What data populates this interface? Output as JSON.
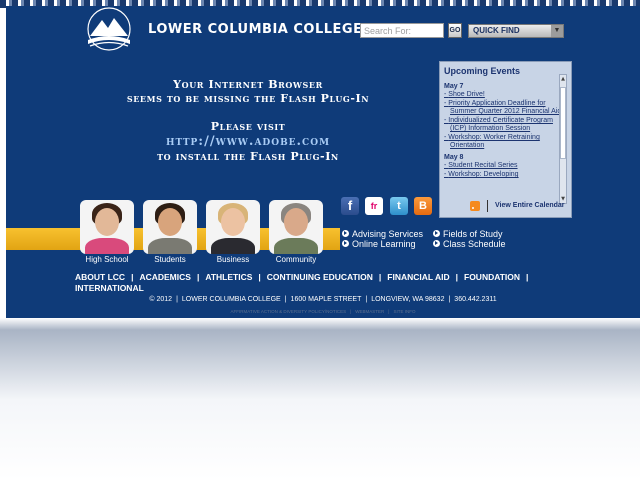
{
  "header": {
    "college_name": "LOWER COLUMBIA COLLEGE",
    "search_placeholder": "Search For:",
    "go_label": "GO",
    "quick_find_label": "QUICK FIND"
  },
  "flash_notice": {
    "line1": "Your Internet Browser",
    "line2": "seems to be missing the Flash Plug-In",
    "line3": "Please visit",
    "link": "http://www.adobe.com",
    "line4": "to install the Flash Plug-In"
  },
  "events": {
    "title": "Upcoming Events",
    "days": [
      {
        "date": "May 7",
        "items": [
          "Shoe Drive!",
          "Priority Application Deadline for Summer Quarter 2012 Financial Aid",
          "Individualized Certificate Program (ICP) Information Session",
          "Workshop: Worker Retraining Orientation"
        ]
      },
      {
        "date": "May 8",
        "items": [
          "Student Recital Series",
          "Workshop: Developing"
        ]
      }
    ],
    "view_calendar_label": "View Entire Calendar"
  },
  "social_icons": [
    "facebook-icon",
    "flickr-icon",
    "twitter-icon",
    "blogger-icon"
  ],
  "social_glyphs": {
    "facebook": "f",
    "flickr": "fr",
    "twitter": "t",
    "blogger": "B"
  },
  "quick_links": {
    "advising": "Advising Services",
    "fields": "Fields of Study",
    "online": "Online Learning",
    "schedule": "Class Schedule"
  },
  "audiences": {
    "high_school": "High School",
    "students": "Students",
    "business": "Business",
    "community": "Community"
  },
  "nav": {
    "about": "ABOUT LCC",
    "academics": "ACADEMICS",
    "athletics": "ATHLETICS",
    "continuing": "CONTINUING EDUCATION",
    "financial_aid": "FINANCIAL AID",
    "foundation": "FOUNDATION",
    "international": "INTERNATIONAL"
  },
  "footer": {
    "copyright": "© 2012",
    "name": "LOWER COLUMBIA COLLEGE",
    "street": "1600 MAPLE STREET",
    "city": "LONGVIEW, WA 98632",
    "phone": "360.442.2311"
  },
  "subfooter": {
    "item1": "AFFIRMATIVE ACTION & DIVERSITY POLICY/NOTICES",
    "item2": "WEBMASTER",
    "item3": "SITE INFO"
  },
  "colors": {
    "navy": "#0f3b79",
    "gold": "#f0b323",
    "link_blue": "#a9ccf5"
  }
}
